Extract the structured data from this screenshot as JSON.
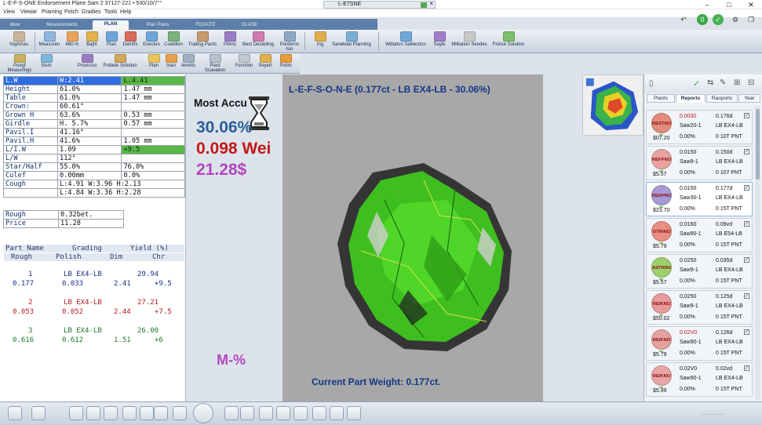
{
  "titlebar": {
    "app_title": "L-E-F-S-ONE Endorsement Plane Sam 2   37127-221 • 530/10/7°°",
    "center_tab": "L-E7SNE",
    "min_icon": "minimize-icon",
    "max_icon": "maximize-icon",
    "close_icon": "close-icon"
  },
  "menu": [
    "View",
    "Viewar",
    "Praming",
    "Potch",
    "Gradies",
    "Tools",
    "Help"
  ],
  "ribbon_tabs": [
    "Mew",
    "Measurements",
    "PLAN",
    "Plan Plans",
    "FDXAITE",
    "GLASE"
  ],
  "ribbon_active_tab": "PLAN",
  "ribbon": [
    {
      "label": "Vaylchas",
      "color": "#c9b59a"
    },
    {
      "label": "Measuren",
      "color": "#8fb6dc"
    },
    {
      "label": "680 m",
      "color": "#e9a35a"
    },
    {
      "label": "Bajht",
      "color": "#e2b24c"
    },
    {
      "label": "Plan",
      "color": "#6ea5d8"
    },
    {
      "label": "Demfts",
      "color": "#d86a5a"
    },
    {
      "label": "Exectun",
      "color": "#6fa8d8"
    },
    {
      "label": "Coeldion",
      "color": "#7bb37a"
    },
    {
      "label": "Trailing Pants",
      "color": "#c89a6a"
    },
    {
      "label": "Pitints",
      "color": "#9b7cc6"
    },
    {
      "label": "Best Destelling",
      "color": "#d07ab0"
    },
    {
      "label": "Porderns Ion",
      "color": "#8fa7c7"
    },
    {
      "label": "Ing",
      "color": "#e0b04c"
    },
    {
      "label": "Sanektial Planning",
      "color": "#7ab0d8"
    },
    {
      "label": "Willation Selliection",
      "color": "#6fa8d8"
    },
    {
      "label": "Sayle",
      "color": "#a57ec8"
    },
    {
      "label": "Milliation Seodes",
      "color": "#c9c9c9"
    },
    {
      "label": "Finiise Solution",
      "color": "#7fbf6a"
    }
  ],
  "ribbon2": [
    {
      "label": "Puegf Measurings",
      "color": "#c8b15a"
    },
    {
      "label": "Sism",
      "color": "#7fb6dc"
    },
    {
      "label": "Proviciso",
      "color": "#9b7cc6"
    },
    {
      "label": "Potiiete Solution",
      "color": "#d2a85a"
    },
    {
      "label": "Plan",
      "color": "#e9c55a"
    },
    {
      "label": "Inan",
      "color": "#e9a04a"
    },
    {
      "label": "Ienetts",
      "color": "#9fb0c2"
    },
    {
      "label": "Piast Scavation",
      "color": "#b5c0cc"
    },
    {
      "label": "Fonction",
      "color": "#c0c8d2"
    },
    {
      "label": "Seyert",
      "color": "#e0b04c"
    },
    {
      "label": "Potim",
      "color": "#e99a3a"
    }
  ],
  "props": [
    {
      "k": "L.W",
      "v1": "W:2.41",
      "v2": "L.4.41",
      "hl": true,
      "v2g": true
    },
    {
      "k": "Height",
      "v1": "61.0%",
      "v2": "1.47 mm"
    },
    {
      "k": "Table",
      "v1": "61.0%",
      "v2": "1.47 mm"
    },
    {
      "k": "Crown:",
      "v1": "60.61°",
      "v2": ""
    },
    {
      "k": "Grown H",
      "v1": "63.6%",
      "v2": "0.53 mm"
    },
    {
      "k": "Girdle",
      "v1": "H. 5.7%",
      "v2": "0.57 mm"
    },
    {
      "k": "Pavil.I",
      "v1": "41.16°",
      "v2": ""
    },
    {
      "k": "Pavil.H",
      "v1": "41.6%",
      "v2": "1.05 mm"
    },
    {
      "k": "L/I.W",
      "v1": "1.09",
      "v2": "+9.5",
      "v2g": true
    },
    {
      "k": "L/W",
      "v1": "112°",
      "v2": ""
    },
    {
      "k": "Star/Half",
      "v1": "55.0%",
      "v2": "76.0%"
    },
    {
      "k": "Culef",
      "v1": "0.00mm",
      "v2": "0.0%"
    },
    {
      "k": "Cough",
      "v1": "L:4.91 W:3.96 H:2.13",
      "v2": "",
      "span": true
    },
    {
      "k": "",
      "v1": "L:4.84 W:3.36 H:2.28",
      "v2": "",
      "span": true
    }
  ],
  "rough_price": [
    {
      "k": "Rough",
      "v": "0.32bet."
    },
    {
      "k": "Price",
      "v": "11.28"
    }
  ],
  "grading": {
    "h1": [
      "Part Name",
      "Grading",
      "Yield (%)"
    ],
    "h2": [
      "Rough",
      "Polish",
      "Dim",
      "Chr"
    ],
    "rows": [
      {
        "n": "1",
        "grade": "LB EX4-LB",
        "yield": "29.94",
        "rough": "0.177",
        "polish": "0.033",
        "dim": "2.41",
        "chr": "+9.5",
        "color": "#1a2f86"
      },
      {
        "n": "2",
        "grade": "LB EX4-LB",
        "yield": "27.21",
        "rough": "0.053",
        "polish": "0.052",
        "dim": "2.44",
        "chr": "+7.5",
        "color": "#b5181d"
      },
      {
        "n": "3",
        "grade": "LB EX4-LB",
        "yield": "26.00",
        "rough": "0.616",
        "polish": "0.612",
        "dim": "1.51",
        "chr": "+6",
        "color": "#1d7a2b"
      }
    ]
  },
  "summary": {
    "most_accurate": "Most Accu",
    "percent": "30.06%",
    "weight": "0.098 Wei",
    "price": "21.28$",
    "m_percent": "M-%"
  },
  "viewport": {
    "title": "L-E-F-S-O-N-E (0.177ct - LB EX4-LB - 30.06%)",
    "footer": "Current Part Weight: 0.177ct."
  },
  "right_tabs": [
    "Plants",
    "Reports",
    "Raoports",
    "Year"
  ],
  "right_active_tab": "Reports",
  "cards": [
    {
      "badge": "REXTNO",
      "disc": "#e38b7c",
      "price": "$07.20",
      "a1": "0.0030",
      "a1red": true,
      "b1": "0.176d",
      "a2": "Saw20-1",
      "b2": "LB EX4-LB",
      "a3": "0.00%",
      "b3": "0 10T PNT",
      "checked": true
    },
    {
      "badge": "REFPNO",
      "disc": "#e8a3a0",
      "price": "$5.57",
      "a1": "0.0150",
      "b1": "0.150d",
      "a2": "Saw9-1",
      "b2": "LB EX4-LB",
      "a3": "0.00%",
      "b3": "0 107 PNT",
      "checked": true
    },
    {
      "badge": "REDPNO",
      "disc": "#a79ad6",
      "price": "$23.70",
      "a1": "0.0150",
      "b1": "0.177d",
      "a2": "Saw30-1",
      "b2": "LB EX4-LB",
      "a3": "0.00%",
      "b3": "0 15T PNT",
      "checked": true,
      "sel": true
    },
    {
      "badge": "OTRINO",
      "disc": "#e88e83",
      "price": "$5.79",
      "a1": "0.0160",
      "b1": "0.09vd",
      "a2": "Saw90-1",
      "b2": "LB E54-LB",
      "a3": "0.00%",
      "b3": "0 15T PNT",
      "checked": true
    },
    {
      "badge": "ASTRINO",
      "disc": "#9fd06f",
      "price": "$5.57",
      "a1": "0.0250",
      "b1": "0.035d",
      "a2": "Saw9-1",
      "b2": "LB EX4-LB",
      "a3": "0.00%",
      "b3": "0 15T PNT",
      "checked": true
    },
    {
      "badge": "REIKNO",
      "disc": "#e89a9a",
      "price": "$50.02",
      "a1": "0.0250",
      "b1": "0.125d",
      "a2": "Saw9-1",
      "b2": "LB EX4-LB",
      "a3": "0.00%",
      "b3": "0 15T PNT",
      "checked": true
    },
    {
      "badge": "REIKNO",
      "disc": "#e5a0a0",
      "price": "$5.79",
      "a1": "0.02V0",
      "a1red": true,
      "b1": "0.126d",
      "a2": "Saw90-1",
      "b2": "LB EX4-LB",
      "a3": "0.00%",
      "b3": "0 15T PNT",
      "checked": true
    },
    {
      "badge": "REIKNO",
      "disc": "#e9a6a6",
      "price": "$5.99",
      "a1": "0.02V0",
      "b1": "0.02vd",
      "a2": "Saw90-1",
      "b2": "LB EX4-LB",
      "a3": "0.00%",
      "b3": "0 15T PNT",
      "checked": true
    }
  ],
  "status_icons": [
    "shape-icon",
    "sliders-icon",
    "circle-icon",
    "diamond-icon",
    "gem-icon",
    "crosshair-icon",
    "layers-icon",
    "cube-icon",
    "split-icon",
    "orbit-icon",
    "zoom-in-icon",
    "zoom-out-icon",
    "mountain-icon",
    "profile-icon",
    "tray-icon",
    "grid-icon",
    "image-icon",
    "table-icon"
  ],
  "watermark": "........."
}
